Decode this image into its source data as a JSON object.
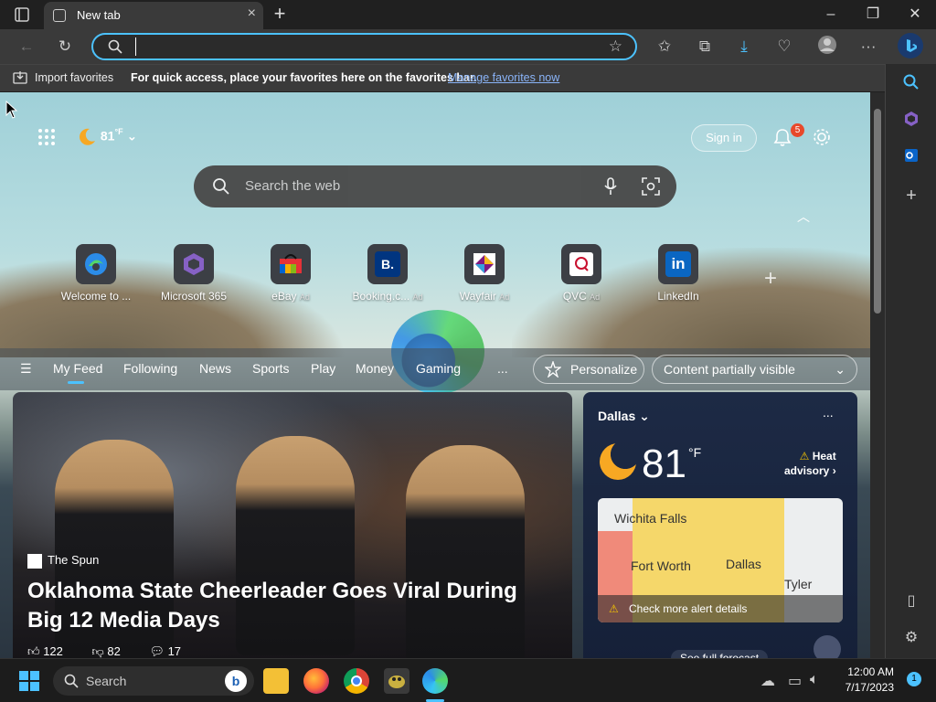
{
  "window": {
    "tab_title": "New tab"
  },
  "toolbar": {
    "address_value": "",
    "address_placeholder": ""
  },
  "favorites_bar": {
    "import_label": "Import favorites",
    "hint": "For quick access, place your favorites here on the favorites bar.",
    "manage_link": "Manage favorites now"
  },
  "header": {
    "temperature": "81",
    "temp_unit": "°F",
    "sign_in": "Sign in",
    "notification_count": "5"
  },
  "search": {
    "placeholder": "Search the web"
  },
  "quick_links": [
    {
      "label": "Welcome to ...",
      "ad": ""
    },
    {
      "label": "Microsoft 365",
      "ad": ""
    },
    {
      "label": "eBay",
      "ad": "Ad"
    },
    {
      "label": "Booking.c...",
      "ad": "Ad"
    },
    {
      "label": "Wayfair",
      "ad": "Ad"
    },
    {
      "label": "QVC",
      "ad": "Ad"
    },
    {
      "label": "LinkedIn",
      "ad": ""
    }
  ],
  "feed_nav": {
    "items": [
      "My Feed",
      "Following",
      "News",
      "Sports",
      "Play",
      "Money",
      "Gaming"
    ],
    "more": "...",
    "personalize": "Personalize",
    "content_visibility": "Content partially visible"
  },
  "news": {
    "source": "The Spun",
    "title": "Oklahoma State Cheerleader Goes Viral During Big 12 Media Days",
    "likes": "122",
    "dislikes": "82",
    "comments": "17"
  },
  "weather": {
    "city": "Dallas",
    "more": "...",
    "temperature": "81",
    "unit": "°F",
    "alert_line1": "Heat",
    "alert_line2": "advisory",
    "map_cities": [
      "Wichita Falls",
      "Fort Worth",
      "Dallas",
      "Tyler"
    ],
    "alert_details": "Check more alert details",
    "forecast_link": "See full forecast"
  },
  "taskbar": {
    "search_placeholder": "Search",
    "time": "12:00 AM",
    "date": "7/17/2023",
    "notification_count": "1"
  },
  "colors": {
    "accent": "#4cc2ff",
    "alert_badge": "#e8492b",
    "heat_zone": "#f5d76a",
    "warning_zone": "#f08a7a"
  }
}
